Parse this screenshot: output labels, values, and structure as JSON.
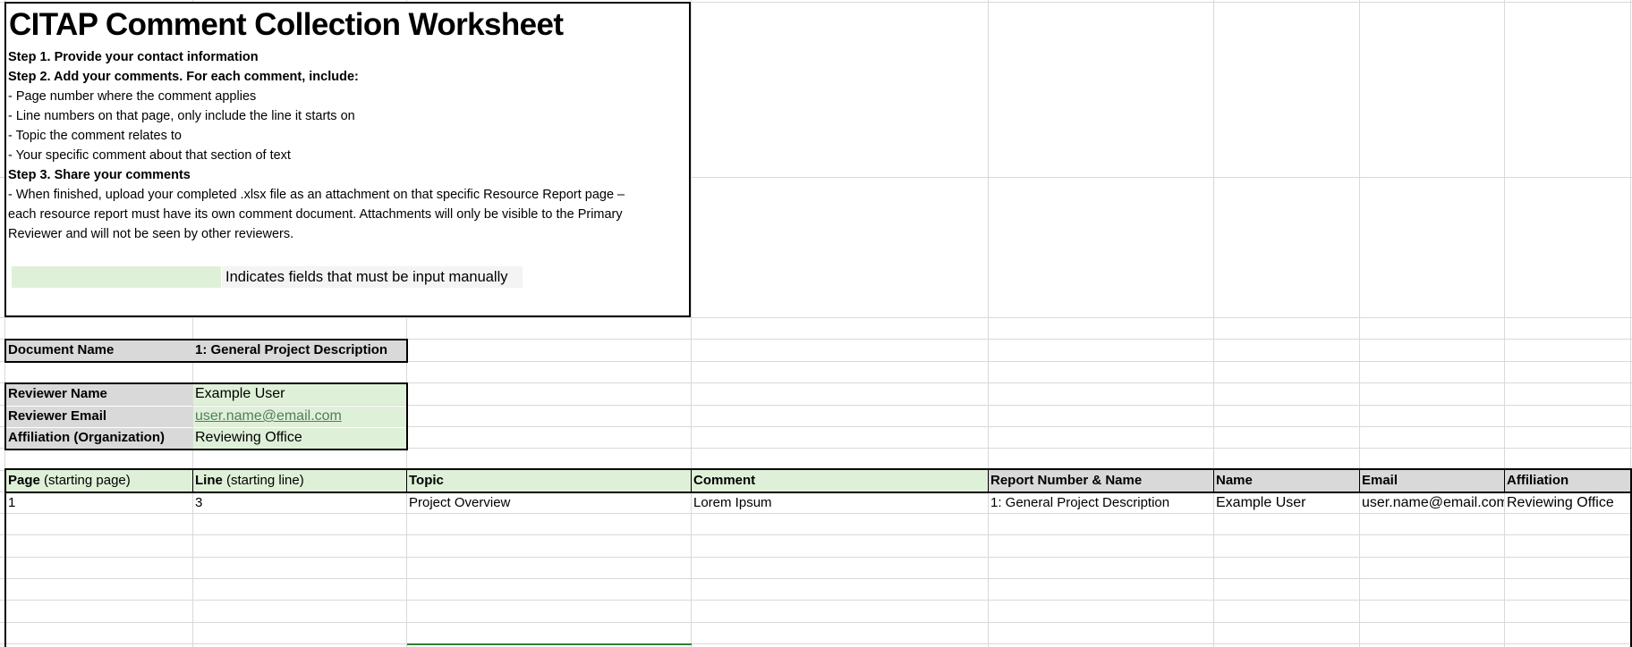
{
  "worksheet": {
    "title": "CITAP Comment Collection Worksheet",
    "step1": "Step 1. Provide your contact information",
    "step2": "Step 2. Add your comments. For each comment, include:",
    "bullet1": "- Page number where the comment applies",
    "bullet2": "- Line numbers on that page, only include the line it starts on",
    "bullet3": "- Topic the comment relates to",
    "bullet4": "- Your specific comment about that section of text",
    "step3": "Step 3. Share your comments",
    "share_line1": "- When finished, upload your completed .xlsx file as an attachment on that specific Resource Report page –",
    "share_line2": "each resource report must have its own comment document. Attachments will only be visible to the Primary",
    "share_line3": "Reviewer and will not be seen by other reviewers.",
    "legend_text": "Indicates fields that must be input manually"
  },
  "document": {
    "label": "Document Name",
    "value": "1: General Project Description"
  },
  "reviewer": {
    "name_label": "Reviewer Name",
    "name_value": "Example User",
    "email_label": "Reviewer Email",
    "email_value": "user.name@email.com",
    "affiliation_label": "Affiliation (Organization)",
    "affiliation_value": "Reviewing Office"
  },
  "table": {
    "headers": {
      "page_bold": "Page",
      "page_thin": " (starting page)",
      "line_bold": "Line",
      "line_thin": " (starting line)",
      "topic": "Topic",
      "comment": "Comment",
      "report": "Report Number & Name",
      "name": "Name",
      "email": "Email",
      "affiliation": "Affiliation"
    },
    "row1": {
      "page": "1",
      "line": "3",
      "topic": "Project Overview",
      "comment": "Lorem Ipsum",
      "report": "1: General Project Description",
      "name": "Example User",
      "email": "user.name@email.com",
      "affiliation": "Reviewing Office"
    }
  },
  "colors": {
    "input_green": "#dff0d8",
    "label_grey": "#d9d9d9",
    "border": "#000000"
  }
}
